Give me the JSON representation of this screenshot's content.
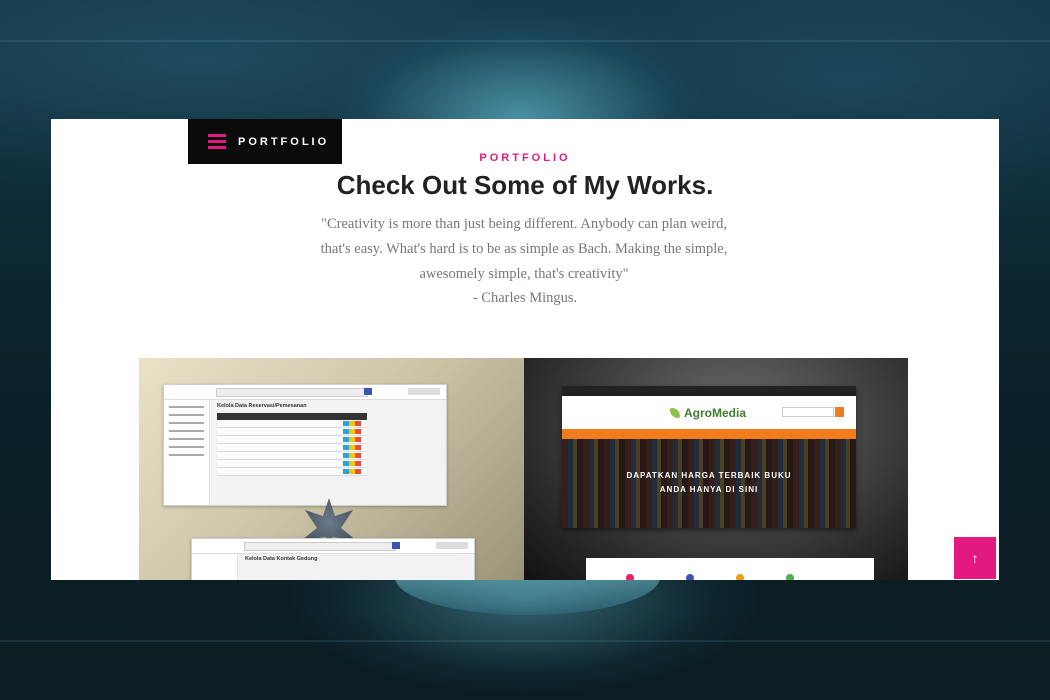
{
  "nav": {
    "menu_label": "PORTFOLIO"
  },
  "section": {
    "eyebrow": "PORTFOLIO",
    "title": "Check Out Some of My Works.",
    "quote_line1": "\"Creativity is more than just being different. Anybody can plan weird,",
    "quote_line2": "that's easy. What's hard is to be as simple as Bach. Making the simple,",
    "quote_line3": "awesomely simple, that's creativity\"",
    "attribution": "- Charles Mingus."
  },
  "projects": [
    {
      "preview_title_1": "Kelola Data Reservasi/Pemesanan",
      "preview_title_2": "Kelola Data Kontak Gedung"
    },
    {
      "brand": "AgroMedia",
      "hero_line1": "DAPATKAN HARGA TERBAIK BUKU",
      "hero_line2": "ANDA HANYA DI SINI"
    }
  ],
  "scroll_top": {
    "icon": "arrow-up-icon",
    "glyph": "↑"
  },
  "colors": {
    "accent": "#e4197f",
    "orange": "#f07c1b",
    "dark": "#0b0b0b"
  }
}
